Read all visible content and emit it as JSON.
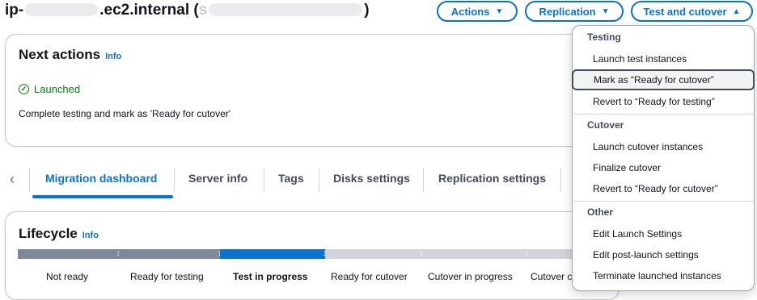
{
  "header": {
    "title_prefix": "ip-",
    "title_suffix": ".ec2.internal (",
    "title_redacted_tail": "s",
    "title_close": ")",
    "actions_label": "Actions",
    "replication_label": "Replication",
    "test_cutover_label": "Test and cutover"
  },
  "next_actions": {
    "title": "Next actions",
    "info": "Info",
    "status": "Launched",
    "description": "Complete testing and mark as 'Ready for cutover'"
  },
  "tabs": [
    {
      "label": "Migration dashboard",
      "active": true
    },
    {
      "label": "Server info"
    },
    {
      "label": "Tags"
    },
    {
      "label": "Disks settings"
    },
    {
      "label": "Replication settings"
    }
  ],
  "lifecycle": {
    "title": "Lifecycle",
    "info": "Info",
    "stages": [
      "Not ready",
      "Ready for testing",
      "Test in progress",
      "Ready for cutover",
      "Cutover in progress",
      "Cutover c"
    ],
    "current_stage": "Test in progress"
  },
  "menu": {
    "groups": [
      {
        "label": "Testing",
        "items": [
          "Launch test instances",
          "Mark as “Ready for cutover”",
          "Revert to “Ready for testing”"
        ]
      },
      {
        "label": "Cutover",
        "items": [
          "Launch cutover instances",
          "Finalize cutover",
          "Revert to “Ready for cutover”"
        ]
      },
      {
        "label": "Other",
        "items": [
          "Edit Launch Settings",
          "Edit post-launch settings",
          "Terminate launched instances"
        ]
      }
    ],
    "highlighted_item": "Mark as “Ready for cutover”"
  },
  "colors": {
    "accent": "#0972d3",
    "success": "#037f0c",
    "progress_done": "#7d8998",
    "progress_todo": "#d1d5db"
  }
}
